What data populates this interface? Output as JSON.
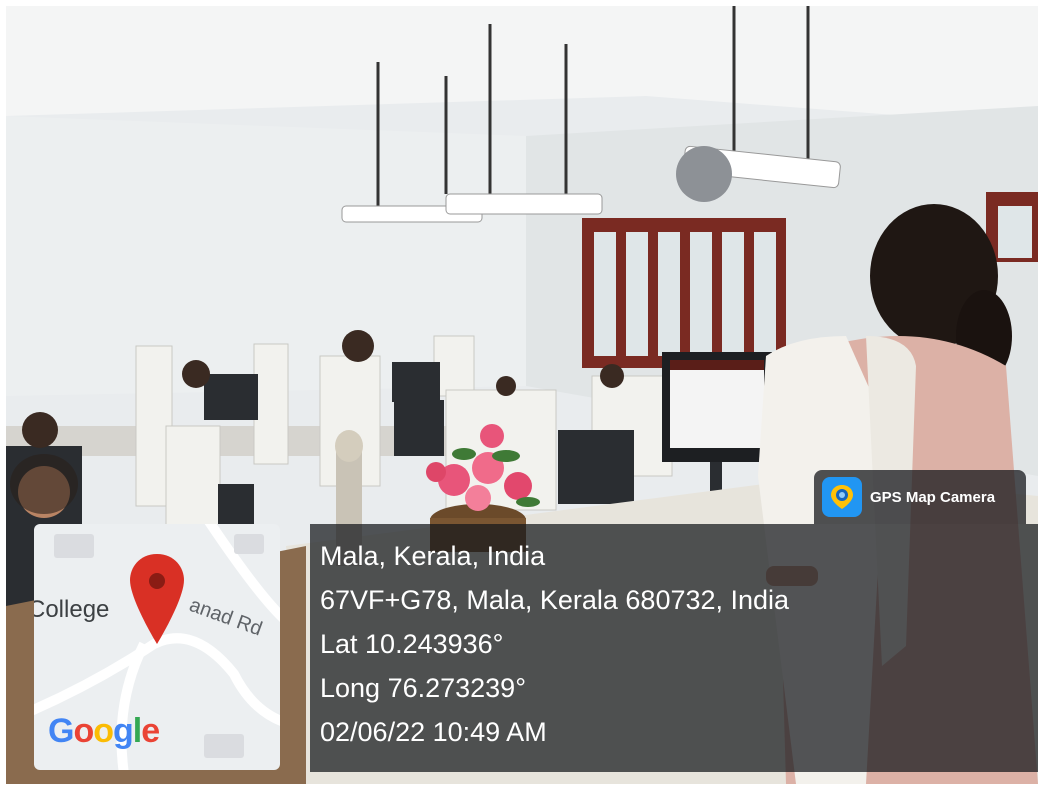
{
  "badge": {
    "icon": "gps-map-camera-icon",
    "label": "GPS Map Camera"
  },
  "stamp": {
    "place": "Mala, Kerala, India",
    "address": "67VF+G78, Mala, Kerala 680732, India",
    "latitude": "Lat 10.243936°",
    "longitude": "Long 76.273239°",
    "datetime": "02/06/22 10:49 AM"
  },
  "map": {
    "place_label": "College",
    "road_label": "anad Rd",
    "provider": "Google",
    "pin_color": "#d93025"
  }
}
